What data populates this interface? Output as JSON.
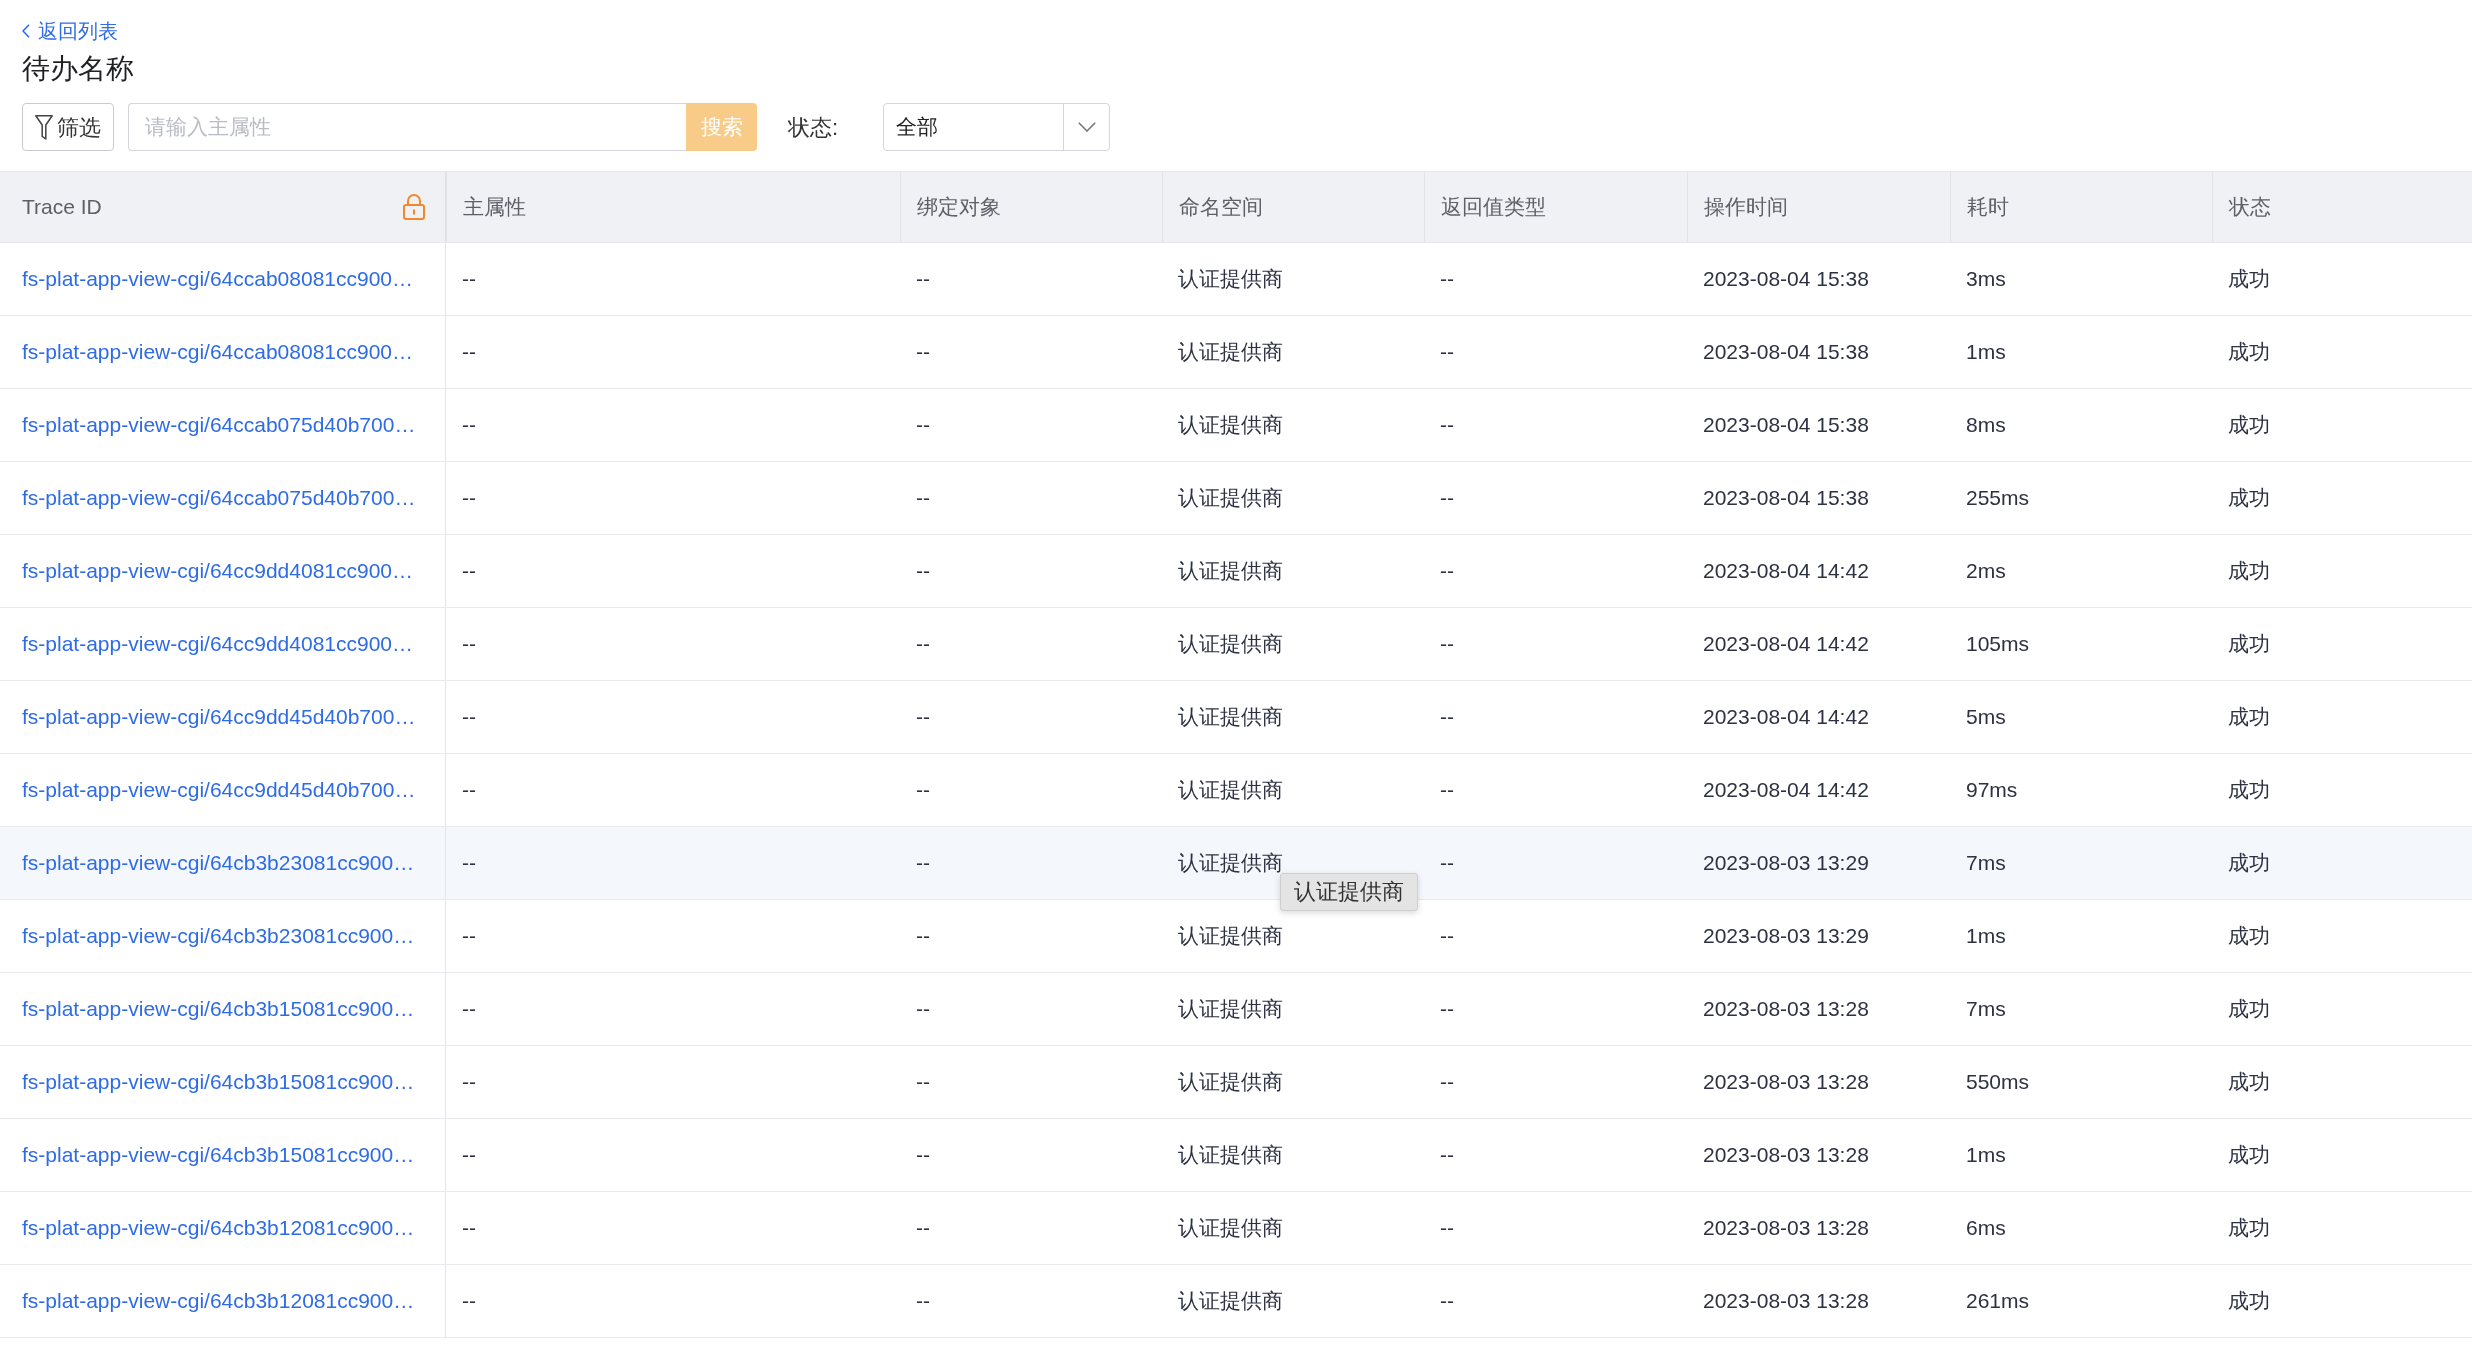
{
  "back_link": {
    "label": "返回列表"
  },
  "title": "待办名称",
  "toolbar": {
    "filter_button": "筛选",
    "search": {
      "placeholder": "请输入主属性",
      "button": "搜索",
      "disabled": true
    },
    "status_filter": {
      "label": "状态:",
      "value": "全部"
    }
  },
  "table": {
    "columns": [
      {
        "label": "Trace ID",
        "kind": "link",
        "pinned": true
      },
      {
        "label": "主属性",
        "kind": "text",
        "pinned": false
      },
      {
        "label": "绑定对象",
        "kind": "text",
        "pinned": false
      },
      {
        "label": "命名空间",
        "kind": "text",
        "pinned": false
      },
      {
        "label": "返回值类型",
        "kind": "text",
        "pinned": false
      },
      {
        "label": "操作时间",
        "kind": "text",
        "pinned": false
      },
      {
        "label": "耗时",
        "kind": "text",
        "pinned": false
      },
      {
        "label": "状态",
        "kind": "text",
        "pinned": false
      }
    ],
    "rows": [
      {
        "cells": [
          "fs-plat-app-view-cgi/64ccab08081cc900…",
          "--",
          "--",
          "认证提供商",
          "--",
          "2023-08-04 15:38",
          "3ms",
          "成功"
        ],
        "hovered": false
      },
      {
        "cells": [
          "fs-plat-app-view-cgi/64ccab08081cc900…",
          "--",
          "--",
          "认证提供商",
          "--",
          "2023-08-04 15:38",
          "1ms",
          "成功"
        ],
        "hovered": false
      },
      {
        "cells": [
          "fs-plat-app-view-cgi/64ccab075d40b700…",
          "--",
          "--",
          "认证提供商",
          "--",
          "2023-08-04 15:38",
          "8ms",
          "成功"
        ],
        "hovered": false
      },
      {
        "cells": [
          "fs-plat-app-view-cgi/64ccab075d40b700…",
          "--",
          "--",
          "认证提供商",
          "--",
          "2023-08-04 15:38",
          "255ms",
          "成功"
        ],
        "hovered": false
      },
      {
        "cells": [
          "fs-plat-app-view-cgi/64cc9dd4081cc900…",
          "--",
          "--",
          "认证提供商",
          "--",
          "2023-08-04 14:42",
          "2ms",
          "成功"
        ],
        "hovered": false
      },
      {
        "cells": [
          "fs-plat-app-view-cgi/64cc9dd4081cc900…",
          "--",
          "--",
          "认证提供商",
          "--",
          "2023-08-04 14:42",
          "105ms",
          "成功"
        ],
        "hovered": false
      },
      {
        "cells": [
          "fs-plat-app-view-cgi/64cc9dd45d40b700…",
          "--",
          "--",
          "认证提供商",
          "--",
          "2023-08-04 14:42",
          "5ms",
          "成功"
        ],
        "hovered": false
      },
      {
        "cells": [
          "fs-plat-app-view-cgi/64cc9dd45d40b700…",
          "--",
          "--",
          "认证提供商",
          "--",
          "2023-08-04 14:42",
          "97ms",
          "成功"
        ],
        "hovered": false
      },
      {
        "cells": [
          "fs-plat-app-view-cgi/64cb3b23081cc900…",
          "--",
          "--",
          "认证提供商",
          "--",
          "2023-08-03 13:29",
          "7ms",
          "成功"
        ],
        "hovered": true,
        "tooltip": "认证提供商"
      },
      {
        "cells": [
          "fs-plat-app-view-cgi/64cb3b23081cc900…",
          "--",
          "--",
          "认证提供商",
          "--",
          "2023-08-03 13:29",
          "1ms",
          "成功"
        ],
        "hovered": false
      },
      {
        "cells": [
          "fs-plat-app-view-cgi/64cb3b15081cc900…",
          "--",
          "--",
          "认证提供商",
          "--",
          "2023-08-03 13:28",
          "7ms",
          "成功"
        ],
        "hovered": false
      },
      {
        "cells": [
          "fs-plat-app-view-cgi/64cb3b15081cc900…",
          "--",
          "--",
          "认证提供商",
          "--",
          "2023-08-03 13:28",
          "550ms",
          "成功"
        ],
        "hovered": false
      },
      {
        "cells": [
          "fs-plat-app-view-cgi/64cb3b15081cc900…",
          "--",
          "--",
          "认证提供商",
          "--",
          "2023-08-03 13:28",
          "1ms",
          "成功"
        ],
        "hovered": false
      },
      {
        "cells": [
          "fs-plat-app-view-cgi/64cb3b12081cc900…",
          "--",
          "--",
          "认证提供商",
          "--",
          "2023-08-03 13:28",
          "6ms",
          "成功"
        ],
        "hovered": false
      },
      {
        "cells": [
          "fs-plat-app-view-cgi/64cb3b12081cc900…",
          "--",
          "--",
          "认证提供商",
          "--",
          "2023-08-03 13:28",
          "261ms",
          "成功"
        ],
        "hovered": false
      }
    ]
  }
}
